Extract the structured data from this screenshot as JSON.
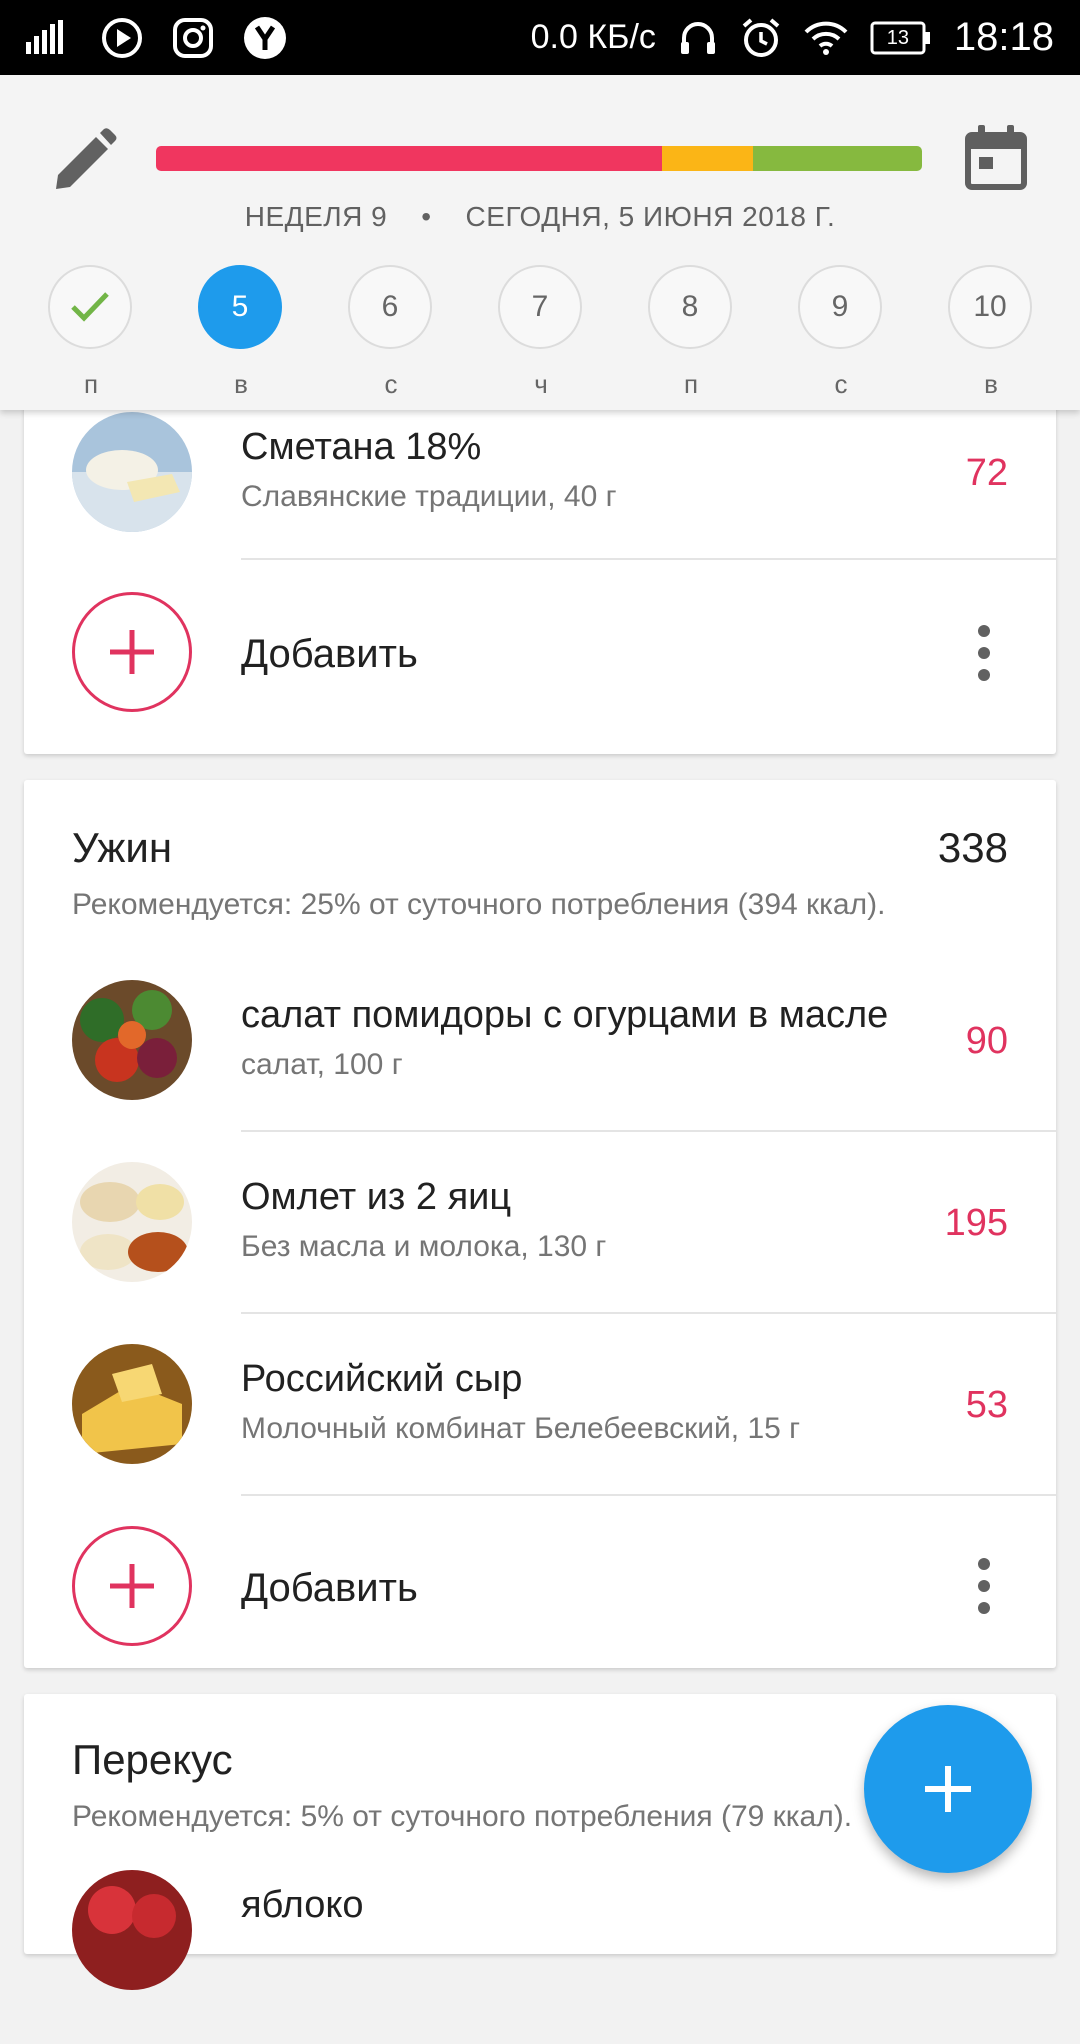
{
  "status_bar": {
    "network_speed": "0.0 КБ/с",
    "battery": "13",
    "time": "18:18",
    "icons": [
      "signal-icon",
      "play-icon",
      "instagram-icon",
      "yandex-icon",
      "headset-icon",
      "alarm-icon",
      "wifi-icon",
      "battery-icon"
    ]
  },
  "header": {
    "week_label": "НЕДЕЛЯ 9",
    "separator": "•",
    "date_label": "СЕГОДНЯ, 5 ИЮНЯ 2018 Г.",
    "progress": {
      "segments": [
        {
          "fraction": 0.66,
          "color": "#f0365f"
        },
        {
          "fraction": 0.12,
          "color": "#fbb516"
        },
        {
          "fraction": 0.22,
          "color": "#86b93f"
        }
      ]
    },
    "days": [
      {
        "number": "",
        "weekday": "п",
        "state": "done"
      },
      {
        "number": "5",
        "weekday": "в",
        "state": "active"
      },
      {
        "number": "6",
        "weekday": "с",
        "state": "normal"
      },
      {
        "number": "7",
        "weekday": "ч",
        "state": "normal"
      },
      {
        "number": "8",
        "weekday": "п",
        "state": "normal"
      },
      {
        "number": "9",
        "weekday": "с",
        "state": "normal"
      },
      {
        "number": "10",
        "weekday": "в",
        "state": "normal"
      }
    ]
  },
  "meals": {
    "top": {
      "items": [
        {
          "name": "Сметана 18%",
          "details": "Славянские традиции, 40 г",
          "kcal": "72"
        }
      ],
      "add_label": "Добавить"
    },
    "dinner": {
      "title": "Ужин",
      "total": "338",
      "recommendation": "Рекомендуется: 25% от суточного потребления (394 ккал).",
      "items": [
        {
          "name": "салат помидоры с огурцами в масле",
          "details": "салат, 100 г",
          "kcal": "90"
        },
        {
          "name": "Омлет из 2 яиц",
          "details": "Без масла и молока, 130 г",
          "kcal": "195"
        },
        {
          "name": "Российский сыр",
          "details": "Молочный комбинат Белебеевский, 15 г",
          "kcal": "53"
        }
      ],
      "add_label": "Добавить"
    },
    "snack": {
      "title": "Перекус",
      "recommendation": "Рекомендуется: 5% от суточного потребления (79 ккал).",
      "items": [
        {
          "name": "яблоко",
          "details": "",
          "kcal": ""
        }
      ]
    }
  },
  "colors": {
    "accent_blue": "#1e9bec",
    "accent_red": "#e0335f"
  }
}
